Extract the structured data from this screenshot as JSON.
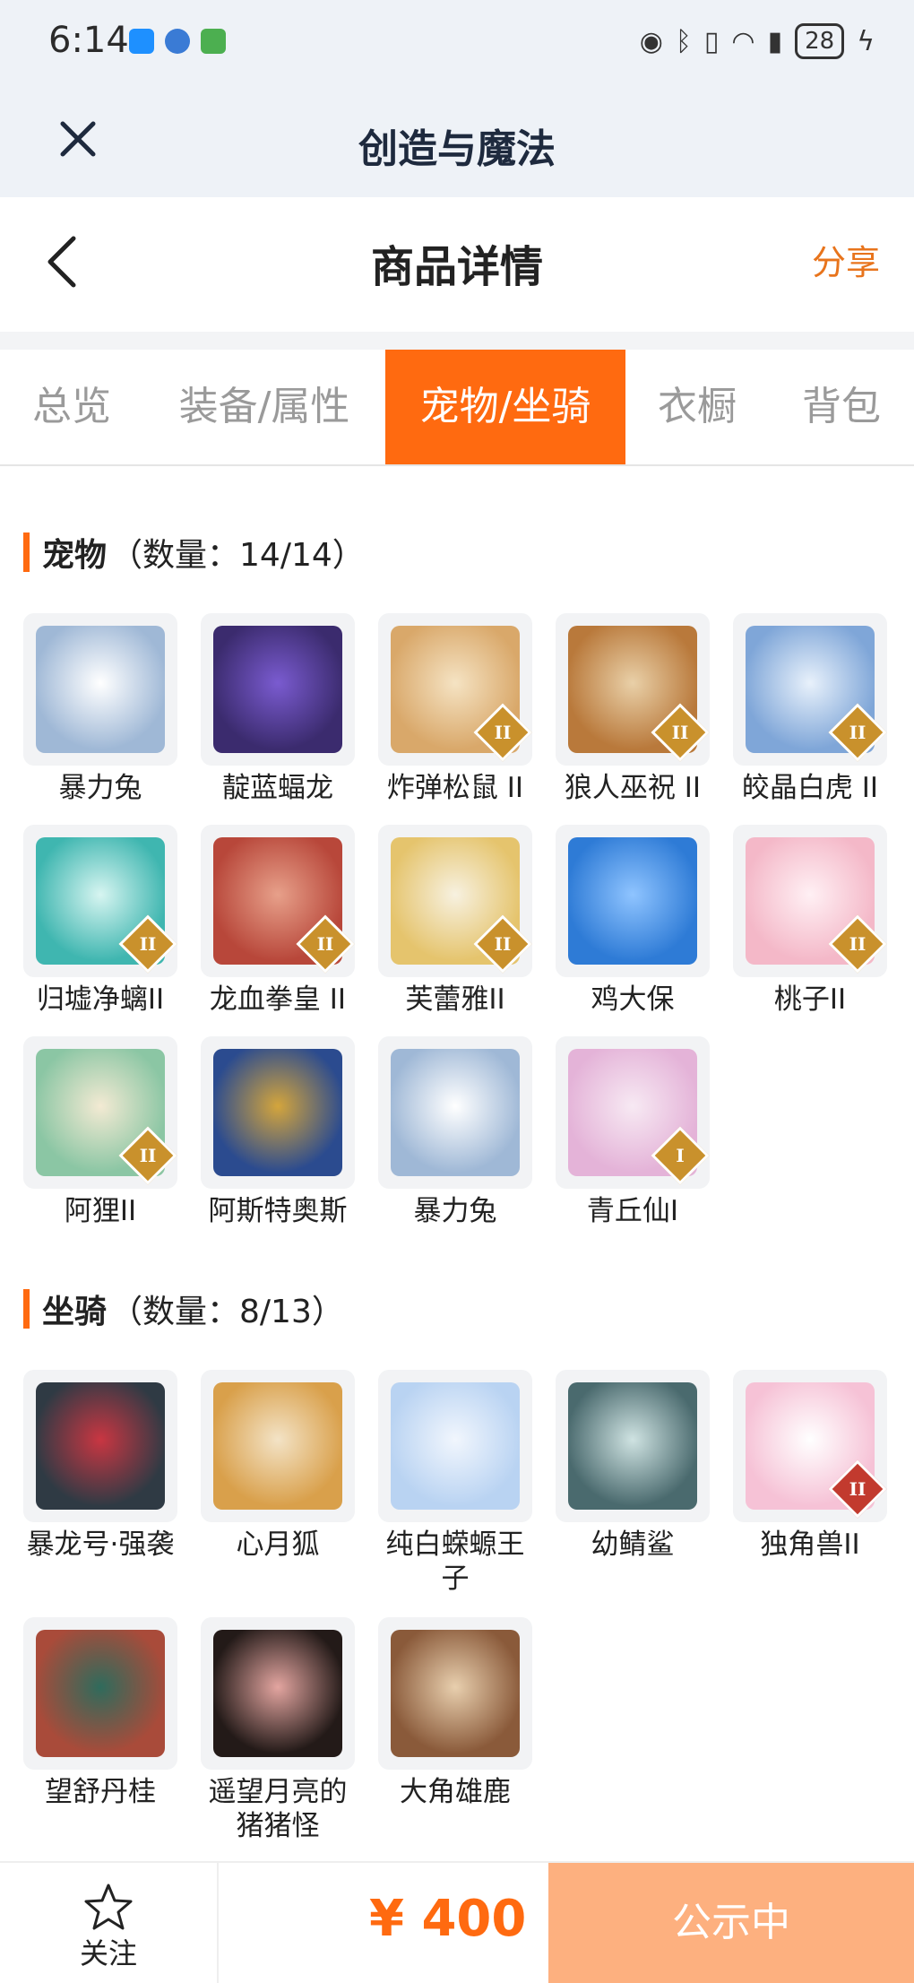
{
  "status_bar": {
    "time": "6:14",
    "battery": "28"
  },
  "app_bar": {
    "title": "创造与魔法"
  },
  "detail_header": {
    "title": "商品详情",
    "share_label": "分享"
  },
  "tabs": [
    {
      "label": "总览",
      "active": false
    },
    {
      "label": "装备/属性",
      "active": false
    },
    {
      "label": "宠物/坐骑",
      "active": true
    },
    {
      "label": "衣橱",
      "active": false
    },
    {
      "label": "背包",
      "active": false
    }
  ],
  "pets": {
    "title": "宠物",
    "count": "（数量：14/14）",
    "items": [
      {
        "name": "暴力兔",
        "badge": ""
      },
      {
        "name": "靛蓝蝠龙",
        "badge": ""
      },
      {
        "name": "炸弹松鼠 II",
        "badge": "II"
      },
      {
        "name": "狼人巫祝 II",
        "badge": "II"
      },
      {
        "name": "皎晶白虎 II",
        "badge": "II"
      },
      {
        "name": "归墟净螭II",
        "badge": "II"
      },
      {
        "name": "龙血拳皇 II",
        "badge": "II"
      },
      {
        "name": "芙蕾雅II",
        "badge": "II"
      },
      {
        "name": "鸡大保",
        "badge": ""
      },
      {
        "name": "桃子II",
        "badge": "II"
      },
      {
        "name": "阿狸II",
        "badge": "II"
      },
      {
        "name": "阿斯特奥斯",
        "badge": ""
      },
      {
        "name": "暴力兔",
        "badge": ""
      },
      {
        "name": "青丘仙I",
        "badge": "I"
      }
    ]
  },
  "mounts": {
    "title": "坐骑",
    "count": "（数量：8/13）",
    "items": [
      {
        "name": "暴龙号·强袭",
        "badge": ""
      },
      {
        "name": "心月狐",
        "badge": ""
      },
      {
        "name": "纯白蝾螈王子",
        "badge": ""
      },
      {
        "name": "幼鲭鲨",
        "badge": ""
      },
      {
        "name": "独角兽II",
        "badge": "II"
      },
      {
        "name": "望舒丹桂",
        "badge": ""
      },
      {
        "name": "遥望月亮的猪猪怪",
        "badge": ""
      },
      {
        "name": "大角雄鹿",
        "badge": ""
      }
    ]
  },
  "bottom_bar": {
    "follow_label": "关注",
    "price": "¥ 400",
    "status_label": "公示中"
  },
  "colors": {
    "accent": "#ff6a10",
    "share": "#e8741c",
    "status_button": "#fdb07f"
  }
}
